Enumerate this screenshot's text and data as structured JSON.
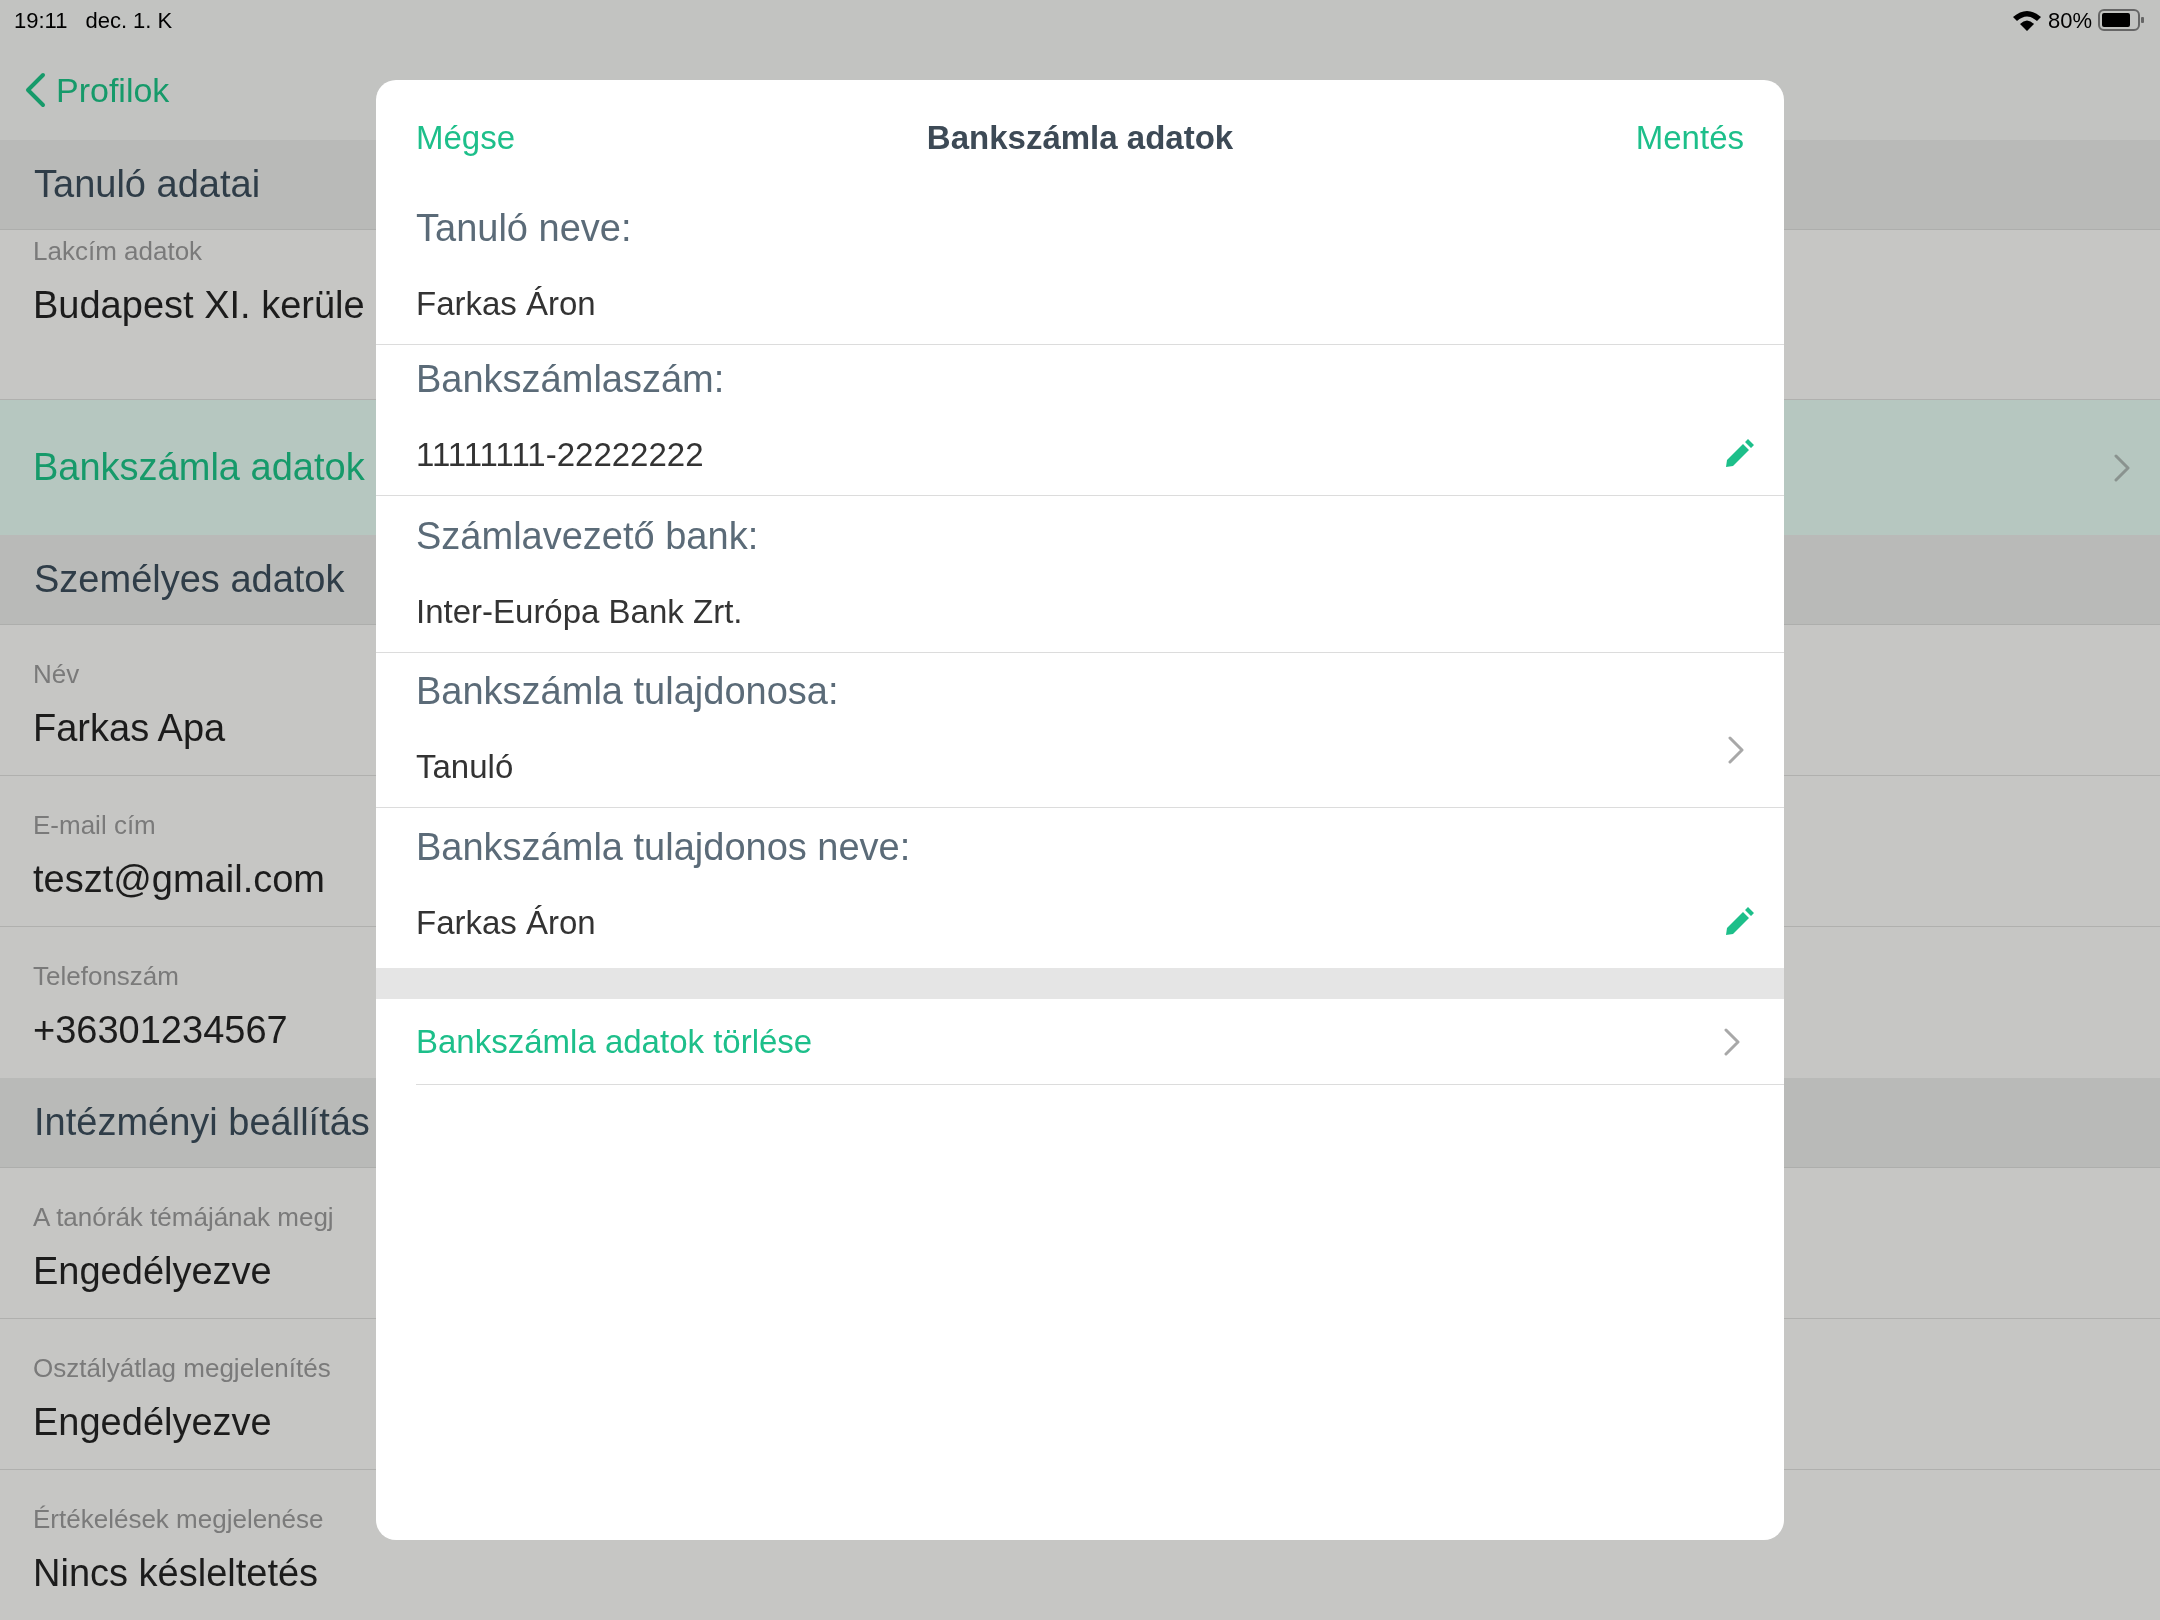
{
  "status_bar": {
    "time": "19:11",
    "date": "dec. 1. K",
    "battery": "80%"
  },
  "nav": {
    "back": "Profilok"
  },
  "sections": [
    {
      "header": "Tanuló adatai",
      "rows": [
        {
          "kind": "field",
          "label": "Lakcím adatok",
          "value": "Budapest XI. kerüle"
        },
        {
          "kind": "link",
          "title": "Bankszámla adatok",
          "selected": true
        }
      ]
    },
    {
      "header": "Személyes adatok",
      "rows": [
        {
          "kind": "field",
          "label": "Név",
          "value": "Farkas Apa"
        },
        {
          "kind": "field",
          "label": "E-mail cím",
          "value": "teszt@gmail.com"
        },
        {
          "kind": "field",
          "label": "Telefonszám",
          "value": "+36301234567"
        }
      ]
    },
    {
      "header": "Intézményi beállítás",
      "rows": [
        {
          "kind": "field",
          "label": "A tanórák témájának megj",
          "value": "Engedélyezve"
        },
        {
          "kind": "field",
          "label": "Osztályátlag megjelenítés",
          "value": "Engedélyezve"
        },
        {
          "kind": "field",
          "label": "Értékelések megjelenése",
          "value": "Nincs késleltetés"
        }
      ]
    }
  ],
  "modal": {
    "title": "Bankszámla adatok",
    "cancel": "Mégse",
    "save": "Mentés",
    "rows": [
      {
        "kind": "text",
        "label": "Tanuló neve:",
        "value": "Farkas Áron"
      },
      {
        "kind": "editable",
        "label": "Bankszámlaszám:",
        "value": "11111111-22222222"
      },
      {
        "kind": "text",
        "label": "Számlavezető bank:",
        "value": "Inter-Európa Bank Zrt."
      },
      {
        "kind": "picker",
        "label": "Bankszámla tulajdonosa:",
        "value": "Tanuló"
      },
      {
        "kind": "editable",
        "label": "Bankszámla tulajdonos neve:",
        "value": "Farkas Áron"
      }
    ],
    "action": "Bankszámla adatok törlése"
  }
}
